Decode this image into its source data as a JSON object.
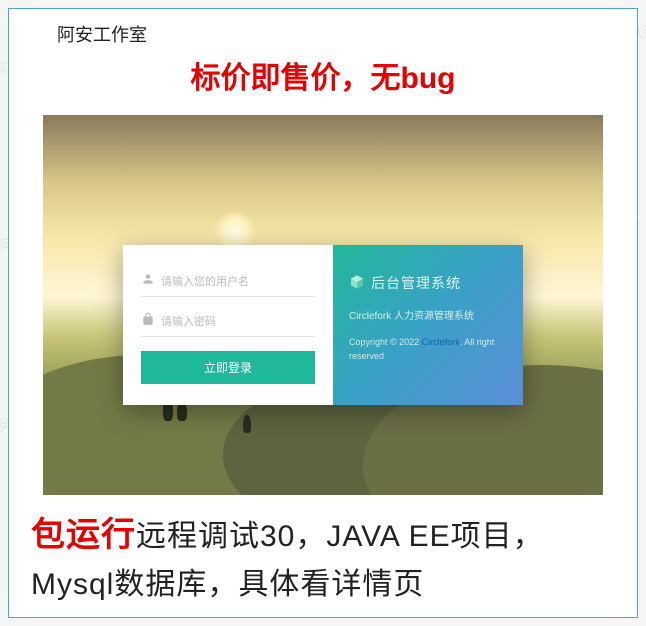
{
  "watermark": "阿安工作室（淘宝）",
  "studio": "阿安工作室",
  "headline": "标价即售价，无bug",
  "login": {
    "username_placeholder": "请输入您的用户名",
    "password_placeholder": "请输入密码",
    "button": "立即登录"
  },
  "panel": {
    "title": "后台管理系统",
    "subtitle": "Circlefork 人力资源管理系统",
    "copyright_prefix": "Copyright © 2022 ",
    "copyright_brand": "Circlefork",
    "copyright_suffix": ". All right reserved"
  },
  "footer": {
    "emph": "包运行",
    "rest": "远程调试30，JAVA EE项目，Mysql数据库，具体看详情页"
  }
}
